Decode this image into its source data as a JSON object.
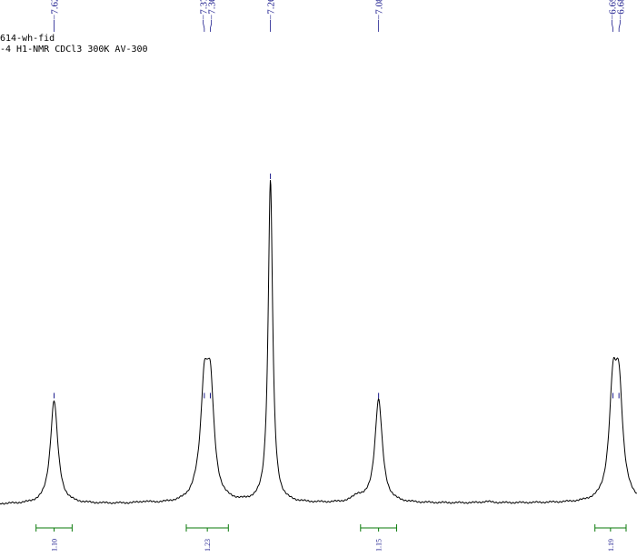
{
  "header": {
    "line1": "614-wh-fid",
    "line2": "-4 H1-NMR CDCl3 300K AV-300"
  },
  "colors": {
    "spectrum": "#000000",
    "peak_labels": "#1a1a8c",
    "integrals": "#0a7a0a"
  },
  "chart_data": {
    "type": "line",
    "title": "",
    "xlabel": "",
    "ylabel": "",
    "x_unit": "ppm",
    "xlim": [
      7.71,
      6.65
    ],
    "x_reversed": true,
    "grid": false,
    "legend": "none",
    "peak_labels": [
      "7.62",
      "7.37",
      "7.36",
      "7.26",
      "7.08",
      "6.69",
      "6.68"
    ],
    "peaks": [
      {
        "ppm": 7.62,
        "height": 0.32
      },
      {
        "ppm": 7.37,
        "height": 0.32
      },
      {
        "ppm": 7.36,
        "height": 0.32
      },
      {
        "ppm": 7.26,
        "height": 1.0
      },
      {
        "ppm": 7.08,
        "height": 0.32
      },
      {
        "ppm": 6.69,
        "height": 0.32
      },
      {
        "ppm": 6.68,
        "height": 0.32
      }
    ],
    "integrals": [
      {
        "from": 7.65,
        "to": 7.59,
        "value": "1.10"
      },
      {
        "from": 7.4,
        "to": 7.33,
        "value": "1.23"
      },
      {
        "from": 7.11,
        "to": 7.05,
        "value": "1.15"
      },
      {
        "from": 6.72,
        "to": 6.65,
        "value": "1.19"
      }
    ]
  }
}
